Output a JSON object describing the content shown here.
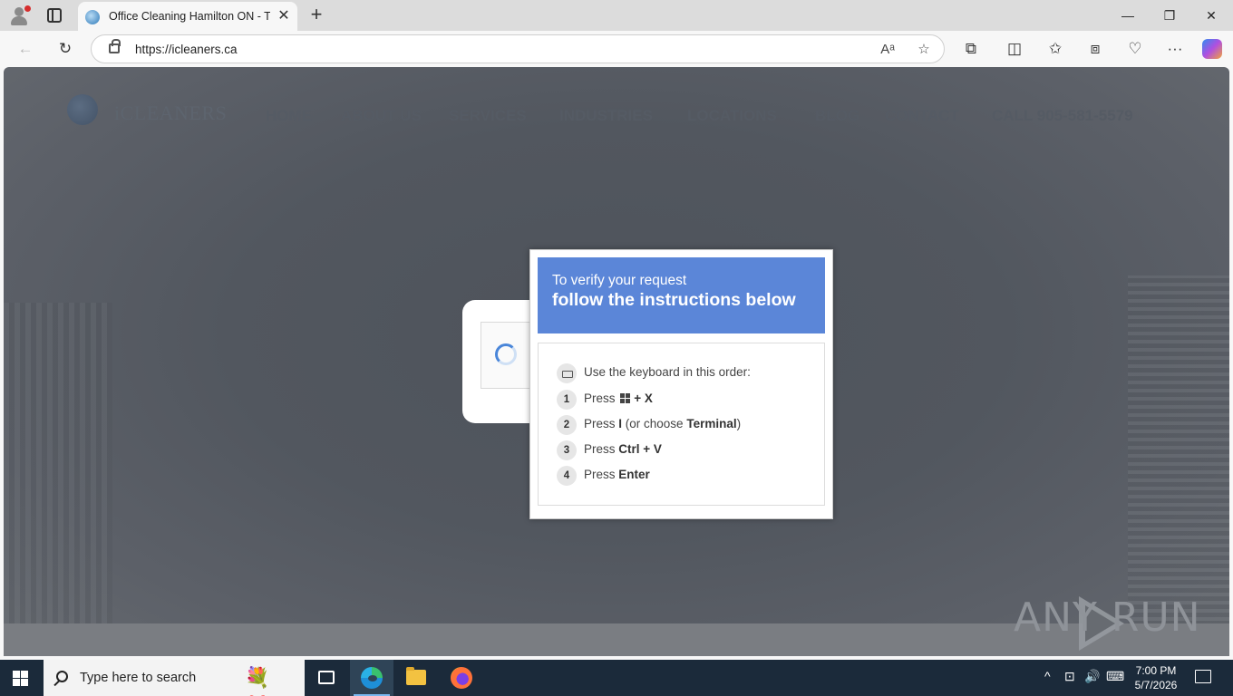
{
  "browser": {
    "tab_title": "Office Cleaning Hamilton ON - Tri",
    "tab_close": "✕",
    "new_tab": "+",
    "url": "https://icleaners.ca",
    "window_controls": {
      "minimize": "—",
      "restore": "❐",
      "close": "✕"
    },
    "toolbar_icons": [
      "back-icon",
      "refresh-icon",
      "read-aloud-icon",
      "favorite-star-icon",
      "extensions-icon",
      "split-screen-icon",
      "favorites-icon",
      "collections-icon",
      "performance-icon",
      "more-icon",
      "copilot-icon"
    ],
    "back": "←",
    "refresh": "↻",
    "read_aloud": "Aᵃ",
    "favorite": "☆",
    "extensions": "⧉",
    "split": "◫",
    "favorites": "✩",
    "collections": "⧈",
    "performance": "♡",
    "more": "···"
  },
  "site": {
    "logo": "iCLEANERS",
    "nav": [
      "HOME",
      "ABOUT US",
      "SERVICES",
      "INDUSTRIES",
      "LOCATIONS",
      "BLOG",
      "CONTACT",
      "CALL 905-581-5579"
    ]
  },
  "popup": {
    "subtitle": "To verify your request",
    "title": "follow the instructions below",
    "intro": "Use the keyboard in this order:",
    "steps": [
      {
        "num": "1",
        "pre": "Press ",
        "key": "+ X",
        "mid": "",
        "key2": "",
        "post": ""
      },
      {
        "num": "2",
        "pre": "Press ",
        "key": "I",
        "mid": " (or choose ",
        "key2": "Terminal",
        "post": ")"
      },
      {
        "num": "3",
        "pre": "Press ",
        "key": "Ctrl + V",
        "mid": "",
        "key2": "",
        "post": ""
      },
      {
        "num": "4",
        "pre": "Press ",
        "key": "Enter",
        "mid": "",
        "key2": "",
        "post": ""
      }
    ]
  },
  "watermark": "ANY RUN",
  "taskbar": {
    "search_placeholder": "Type here to search",
    "search_decoration": "💐🎁",
    "time": "7:00 PM",
    "date": "5/7/2026",
    "tray": {
      "chevron": "^",
      "network": "⊡",
      "volume": "🔊",
      "keyboard": "⌨"
    }
  },
  "colors": {
    "popup_header": "#5b86d8",
    "taskbar": "#1b2a3a",
    "overlay": "#52575f"
  }
}
